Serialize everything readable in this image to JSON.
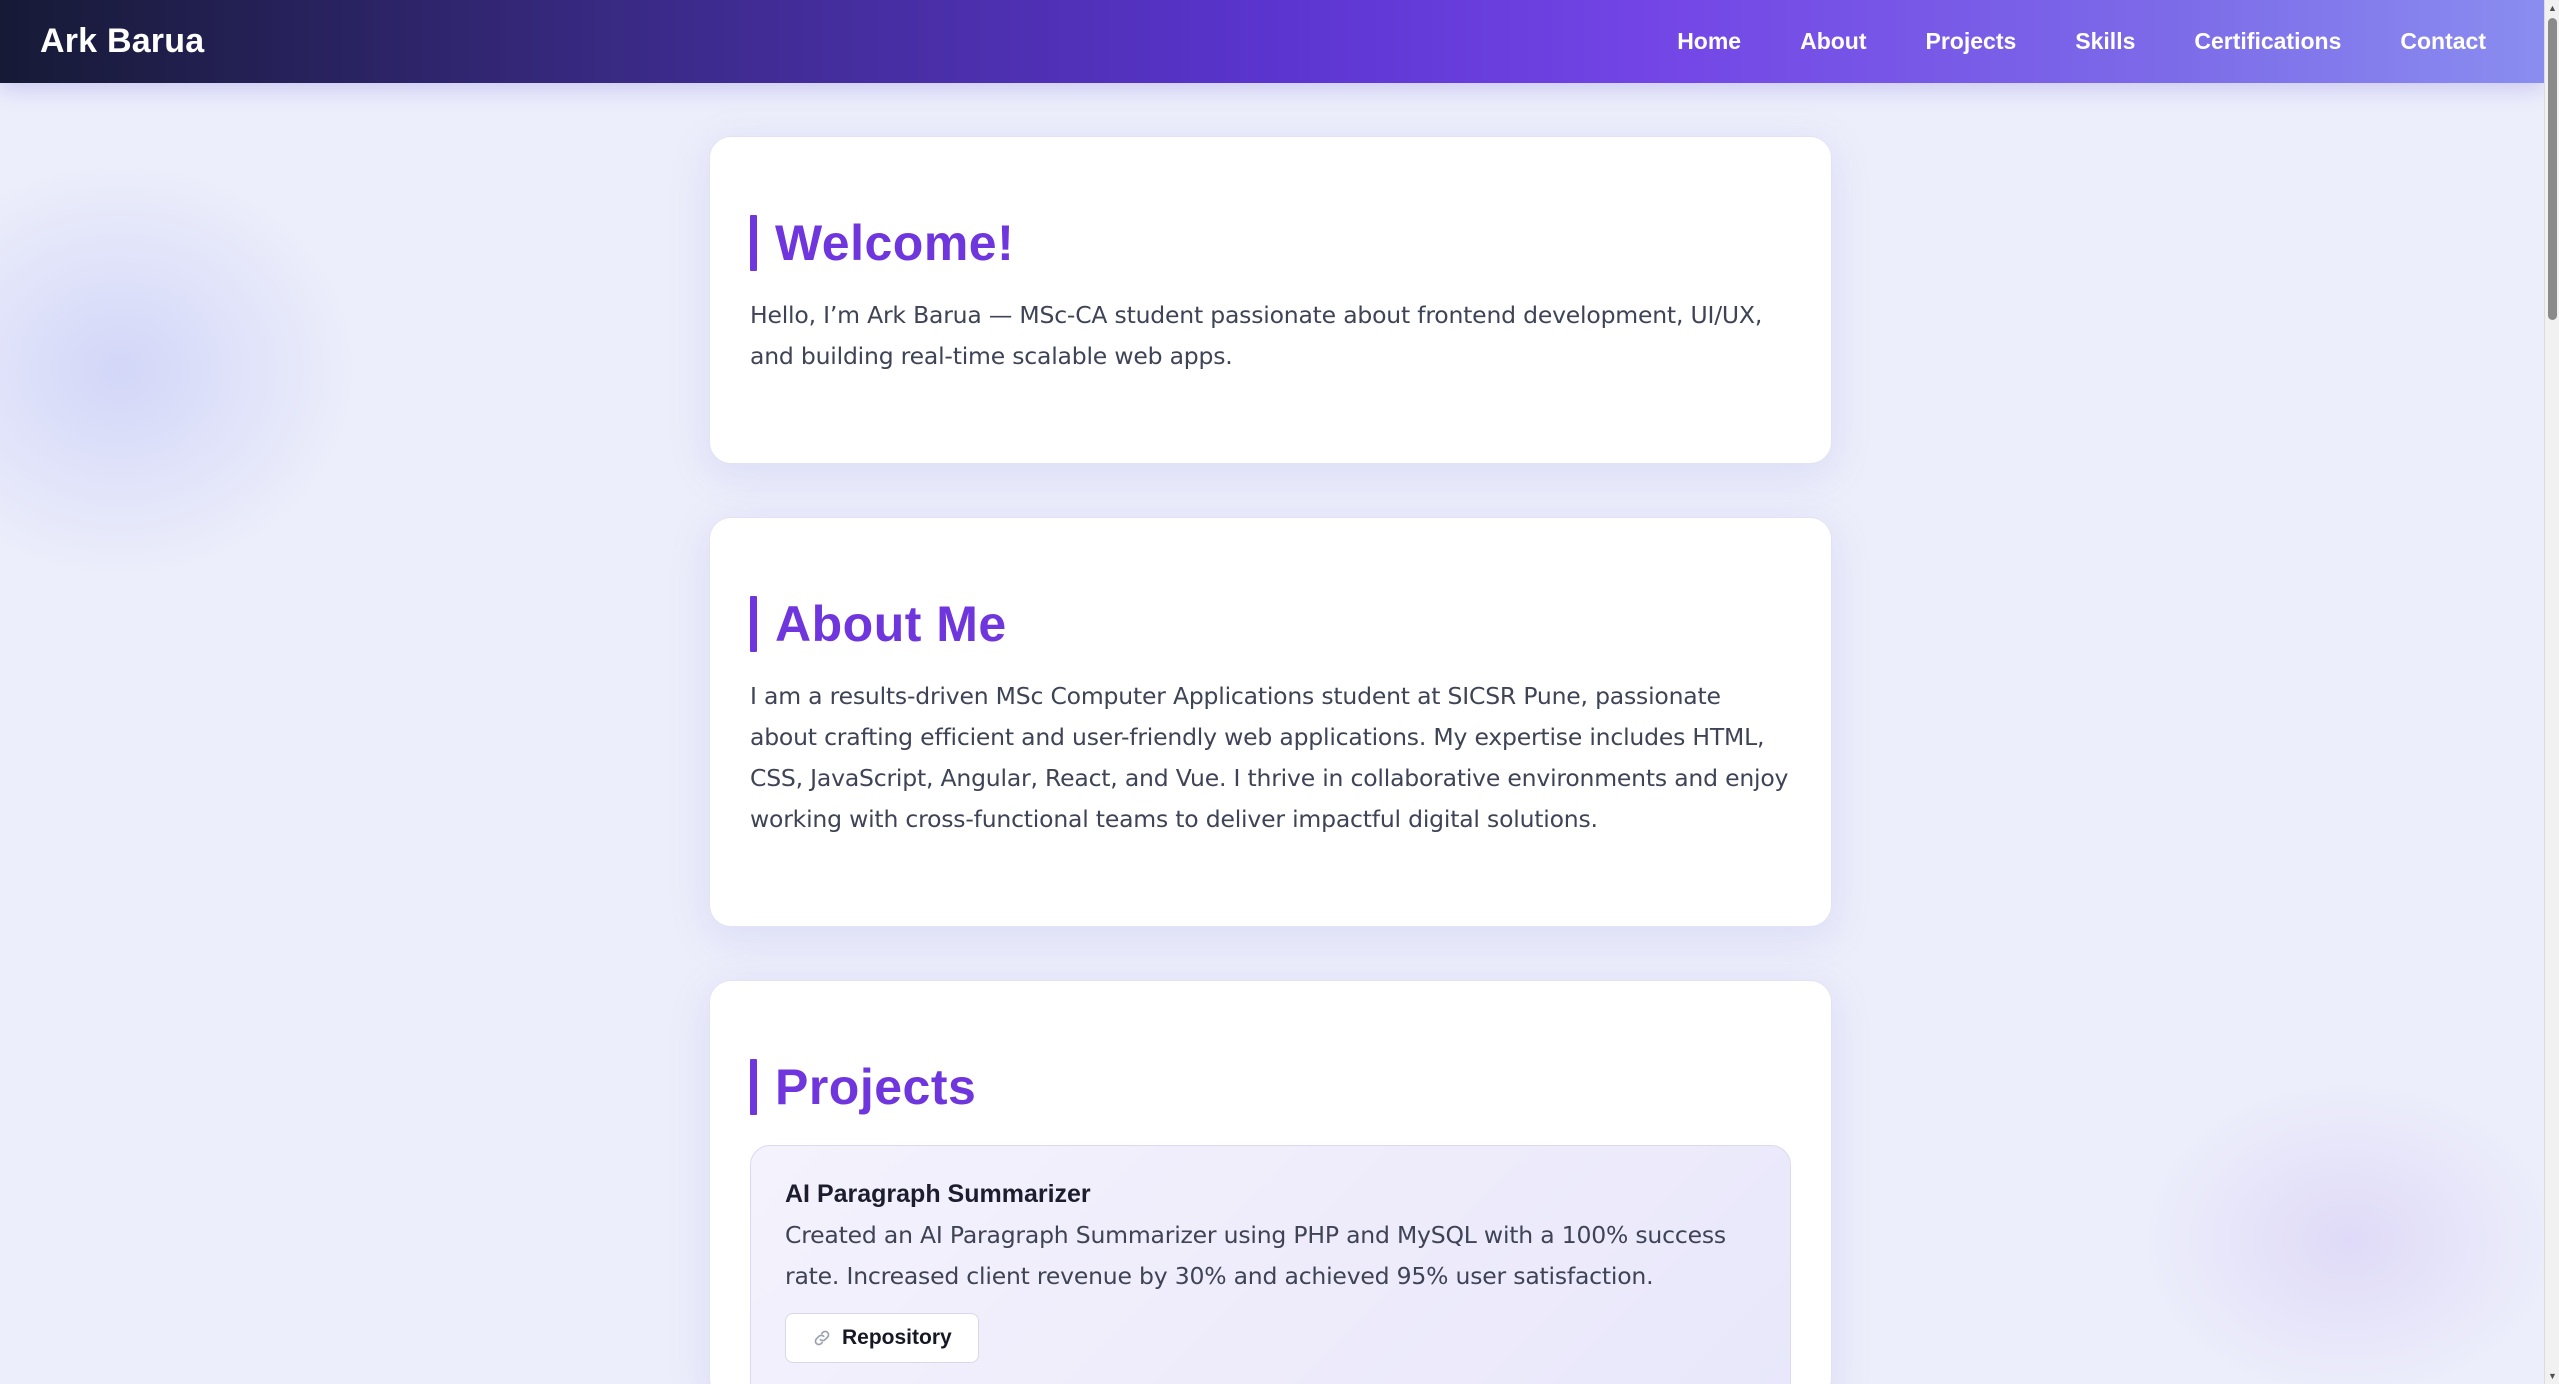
{
  "nav": {
    "brand": "Ark Barua",
    "links": [
      "Home",
      "About",
      "Projects",
      "Skills",
      "Certifications",
      "Contact"
    ]
  },
  "welcome": {
    "title": "Welcome!",
    "text": "Hello, I’m Ark Barua — MSc-CA student passionate about frontend development, UI/UX, and building real-time scalable web apps."
  },
  "about": {
    "title": "About Me",
    "text": "I am a results-driven MSc Computer Applications student at SICSR Pune, passionate about crafting efficient and user-friendly web applications. My expertise includes HTML, CSS, JavaScript, Angular, React, and Vue. I thrive in collaborative environments and enjoy working with cross-functional teams to deliver impactful digital solutions."
  },
  "projects": {
    "title": "Projects",
    "items": [
      {
        "name": "AI Paragraph Summarizer",
        "description": "Created an AI Paragraph Summarizer using PHP and MySQL with a 100% success rate. Increased client revenue by 30% and achieved 95% user satisfaction.",
        "button_label": "Repository",
        "button_icon": "link-icon"
      }
    ]
  },
  "colors": {
    "accent": "#7036dd",
    "nav_start": "#161a35",
    "nav_end": "#8a8df0",
    "page_bg": "#eceefb"
  }
}
